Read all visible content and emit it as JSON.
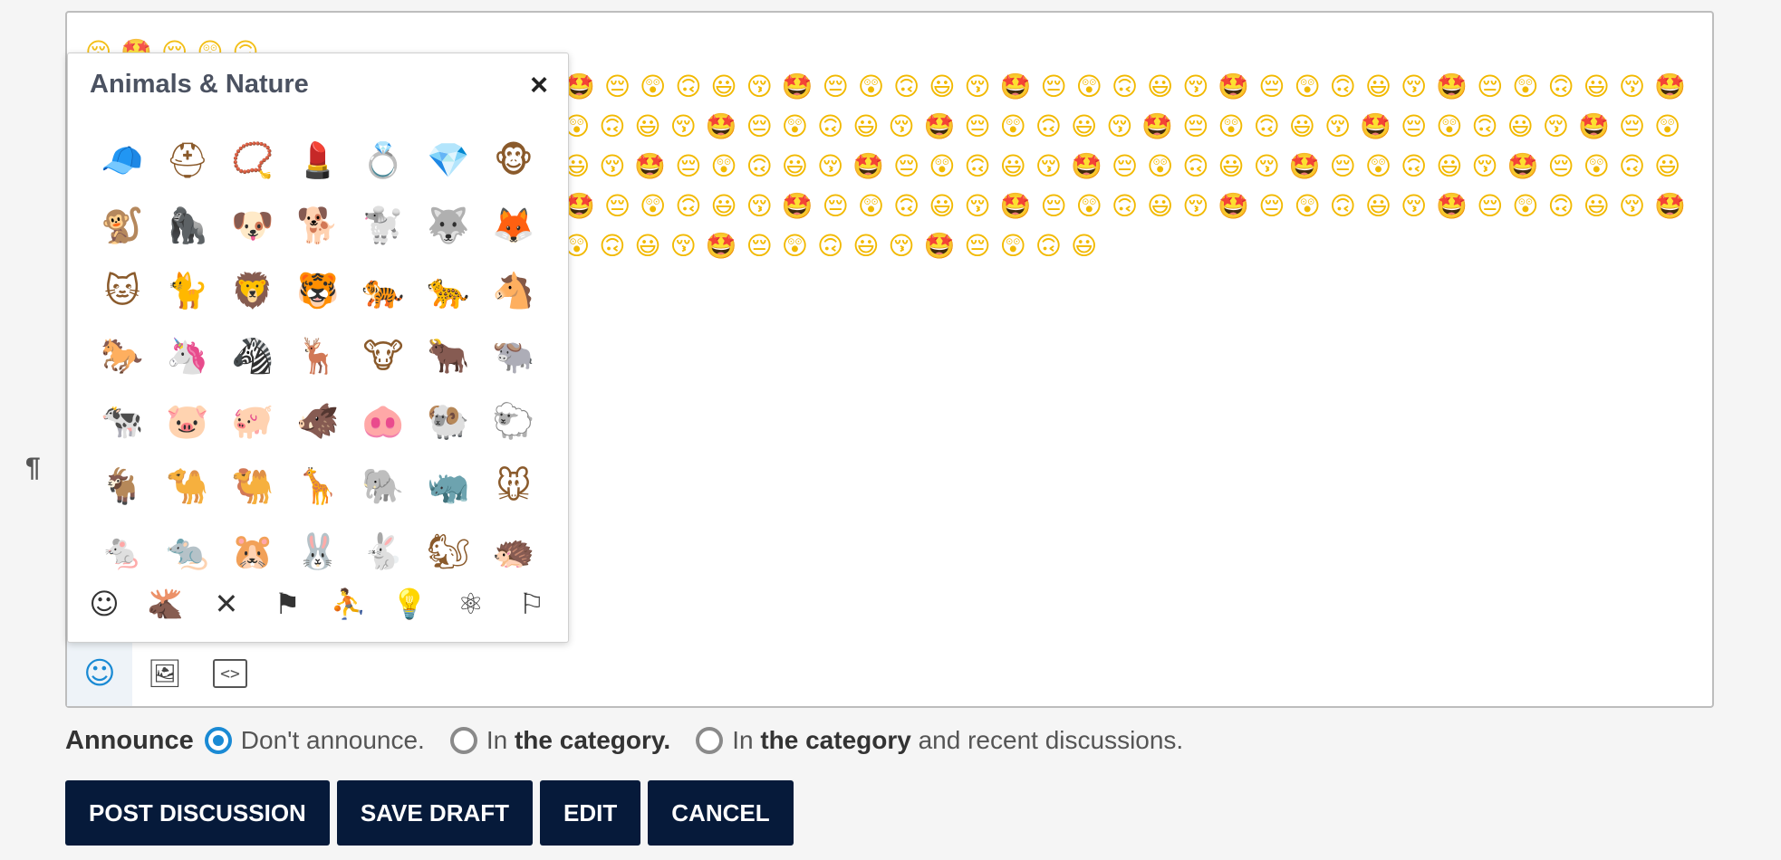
{
  "editor": {
    "pilcrow": "¶",
    "partial_top_line": "😚🤩😔😲🙃",
    "content_lines": [
      "🤩😔😲🙃😃😚🤩😔😲🙃😃😚🤩😔😲🙃😃😚🤩😔😲🙃😃😚🤩😔😲🙃😃😚🤩",
      "😲🙃😃😚🤩😔😲🙃😃😚🤩😔😲🙃😃😚🤩😔😲🙃😃😚🤩😔😲🙃😃😚🤩😔😲",
      "😃😚🤩😔😲🙃😃😚🤩😔😲🙃😃😚🤩😔😲🙃😃😚🤩😔😲🙃😃😚🤩😔😲🙃😃",
      "🤩😔😲🙃😃😚🤩😔😲🙃😃😚🤩😔😲🙃😃😚🤩😔😲🙃😃😚🤩😔😲🙃😃😚🤩",
      "😲🙃😃😚🤩😔😲🙃😃😚🤩😔😲🙃😃"
    ]
  },
  "emoji_picker": {
    "title": "Animals & Nature",
    "close_glyph": "×",
    "emojis": [
      "🧢",
      "⛑",
      "📿",
      "💄",
      "💍",
      "💎",
      "🐵",
      "🐒",
      "🦍",
      "🐶",
      "🐕",
      "🐩",
      "🐺",
      "🦊",
      "🐱",
      "🐈",
      "🦁",
      "🐯",
      "🐅",
      "🐆",
      "🐴",
      "🐎",
      "🦄",
      "🦓",
      "🦌",
      "🐮",
      "🐂",
      "🐃",
      "🐄",
      "🐷",
      "🐖",
      "🐗",
      "🐽",
      "🐏",
      "🐑",
      "🐐",
      "🐪",
      "🐫",
      "🦒",
      "🐘",
      "🦏",
      "🐭",
      "🐁",
      "🐀",
      "🐹",
      "🐰",
      "🐇",
      "🐿",
      "🦔"
    ],
    "categories": [
      {
        "icon": "☺",
        "name": "smileys"
      },
      {
        "icon": "🫎",
        "name": "animals"
      },
      {
        "icon": "✕",
        "name": "food"
      },
      {
        "icon": "⚑",
        "name": "travel"
      },
      {
        "icon": "⛹",
        "name": "activities"
      },
      {
        "icon": "💡",
        "name": "objects"
      },
      {
        "icon": "⚛",
        "name": "symbols"
      },
      {
        "icon": "⚐",
        "name": "flags"
      }
    ]
  },
  "toolbar": {
    "emoji_icon": "☺",
    "image_icon": "🖼",
    "code_icon": "<>"
  },
  "announce": {
    "label": "Announce",
    "opt1": "Don't announce.",
    "opt2_pre": "In ",
    "opt2_bold": "the category.",
    "opt3_pre": "In ",
    "opt3_bold": "the category",
    "opt3_post": " and recent discussions."
  },
  "buttons": {
    "post": "POST DISCUSSION",
    "save": "SAVE DRAFT",
    "edit": "EDIT",
    "cancel": "CANCEL"
  },
  "colors": {
    "accent": "#1a8ad4",
    "button_bg": "#061a3a"
  }
}
